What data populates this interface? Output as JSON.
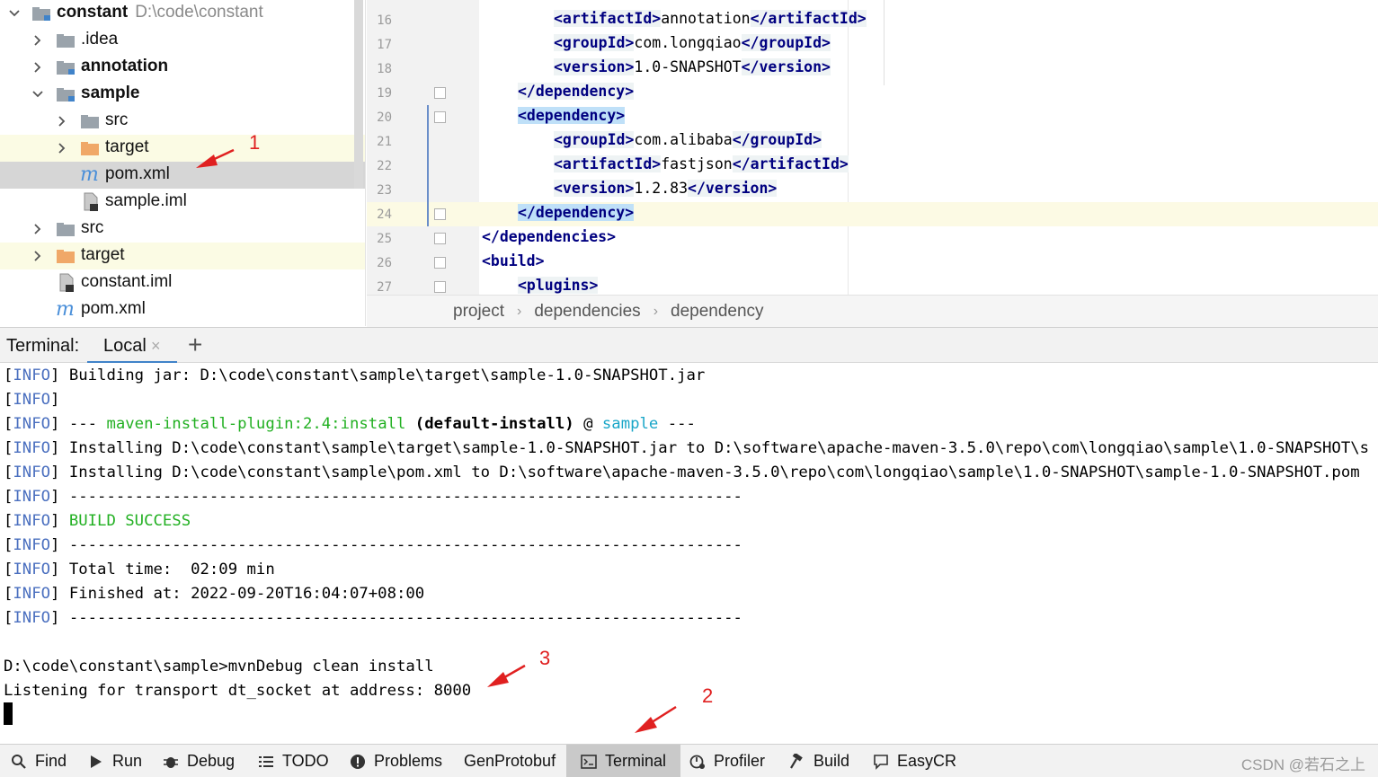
{
  "project_tree": {
    "items": [
      {
        "label": "constant",
        "path": "D:\\code\\constant",
        "bold": true
      },
      {
        "label": ".idea"
      },
      {
        "label": "annotation",
        "bold": true
      },
      {
        "label": "sample",
        "bold": true
      },
      {
        "label": "src"
      },
      {
        "label": "target"
      },
      {
        "label": "pom.xml",
        "icon_letter": "m"
      },
      {
        "label": "sample.iml"
      },
      {
        "label": "src"
      },
      {
        "label": "target"
      },
      {
        "label": "constant.iml"
      },
      {
        "label": "pom.xml",
        "icon_letter": "m"
      }
    ]
  },
  "editor": {
    "line_numbers": [
      "16",
      "17",
      "18",
      "19",
      "20",
      "21",
      "22",
      "23",
      "24",
      "25",
      "26",
      "27"
    ],
    "lines": [
      {
        "tag1": "<artifactId>",
        "text": "annotation",
        "tag2": "</artifactId>"
      },
      {
        "tag1": "<groupId>",
        "text": "com.longqiao",
        "tag2": "</groupId>"
      },
      {
        "tag1": "<version>",
        "text": "1.0-SNAPSHOT",
        "tag2": "</version>"
      },
      {
        "tag1": "</dependency>"
      },
      {
        "tag1": "<dependency>"
      },
      {
        "tag1": "<groupId>",
        "text": "com.alibaba",
        "tag2": "</groupId>"
      },
      {
        "tag1": "<artifactId>",
        "text": "fastjson",
        "tag2": "</artifactId>"
      },
      {
        "tag1": "<version>",
        "text": "1.2.83",
        "tag2": "</version>"
      },
      {
        "tag1": "</dependency>"
      },
      {
        "tag1": "</dependencies>"
      },
      {
        "tag1": "<build>"
      },
      {
        "tag1": "<plugins>"
      }
    ]
  },
  "breadcrumb": {
    "items": [
      "project",
      "dependencies",
      "dependency"
    ],
    "separator": "›"
  },
  "terminal": {
    "title": "Terminal:",
    "tab_label": "Local",
    "close_glyph": "×",
    "add_glyph": "+",
    "info_tag": "INFO",
    "lines": [
      {
        "text": "Building jar: D:\\code\\constant\\sample\\target\\sample-1.0-SNAPSHOT.jar"
      },
      {
        "text": ""
      },
      {
        "pre": "--- ",
        "plugin": "maven-install-plugin:2.4:install",
        "mid": " (default-install)",
        "at": " @ ",
        "module": "sample",
        "post": " ---"
      },
      {
        "text": "Installing D:\\code\\constant\\sample\\target\\sample-1.0-SNAPSHOT.jar to D:\\software\\apache-maven-3.5.0\\repo\\com\\longqiao\\sample\\1.0-SNAPSHOT\\s"
      },
      {
        "text": "Installing D:\\code\\constant\\sample\\pom.xml to D:\\software\\apache-maven-3.5.0\\repo\\com\\longqiao\\sample\\1.0-SNAPSHOT\\sample-1.0-SNAPSHOT.pom"
      },
      {
        "text": "------------------------------------------------------------------------"
      },
      {
        "success": "BUILD SUCCESS"
      },
      {
        "text": "------------------------------------------------------------------------"
      },
      {
        "text": "Total time:  02:09 min"
      },
      {
        "text": "Finished at: 2022-09-20T16:04:07+08:00"
      },
      {
        "text": "------------------------------------------------------------------------"
      }
    ],
    "command": "D:\\code\\constant\\sample>mvnDebug clean install",
    "output": "Listening for transport dt_socket at address: 8000"
  },
  "annotations": [
    "1",
    "2",
    "3"
  ],
  "toolbar": {
    "items": [
      {
        "label": "Find",
        "icon": "search-icon"
      },
      {
        "label": "Run",
        "icon": "run-icon"
      },
      {
        "label": "Debug",
        "icon": "bug-icon"
      },
      {
        "label": "TODO",
        "icon": "list-icon"
      },
      {
        "label": "Problems",
        "icon": "info-icon"
      },
      {
        "label": "GenProtobuf",
        "icon": ""
      },
      {
        "label": "Terminal",
        "icon": "terminal-icon",
        "active": true
      },
      {
        "label": "Profiler",
        "icon": "profiler-icon"
      },
      {
        "label": "Build",
        "icon": "hammer-icon"
      },
      {
        "label": "EasyCR",
        "icon": "comment-icon"
      }
    ],
    "watermark": "CSDN @若石之上"
  },
  "colors": {
    "info": "#4a6fbf",
    "success": "#22b022",
    "module": "#19a6c8",
    "tag": "#000080",
    "annotation": "#e02020",
    "selection": "#bfe0f8"
  }
}
